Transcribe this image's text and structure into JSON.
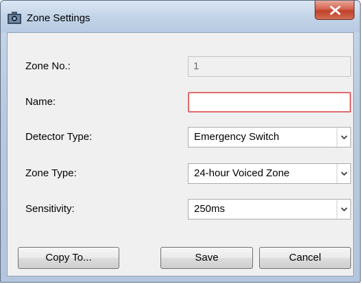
{
  "window": {
    "title": "Zone Settings",
    "close_icon": "close-x-icon",
    "app_icon": "app-camera-icon"
  },
  "form": {
    "zone_no": {
      "label": "Zone No.:",
      "value": "1"
    },
    "name": {
      "label": "Name:",
      "value": "",
      "placeholder": ""
    },
    "detector_type": {
      "label": "Detector Type:",
      "value": "Emergency Switch"
    },
    "zone_type": {
      "label": "Zone Type:",
      "value": "24-hour Voiced Zone"
    },
    "sensitivity": {
      "label": "Sensitivity:",
      "value": "250ms"
    }
  },
  "buttons": {
    "copy_to": "Copy To...",
    "save": "Save",
    "cancel": "Cancel"
  },
  "colors": {
    "name_field_border": "#e06a6a",
    "close_button": "#c0412b"
  }
}
